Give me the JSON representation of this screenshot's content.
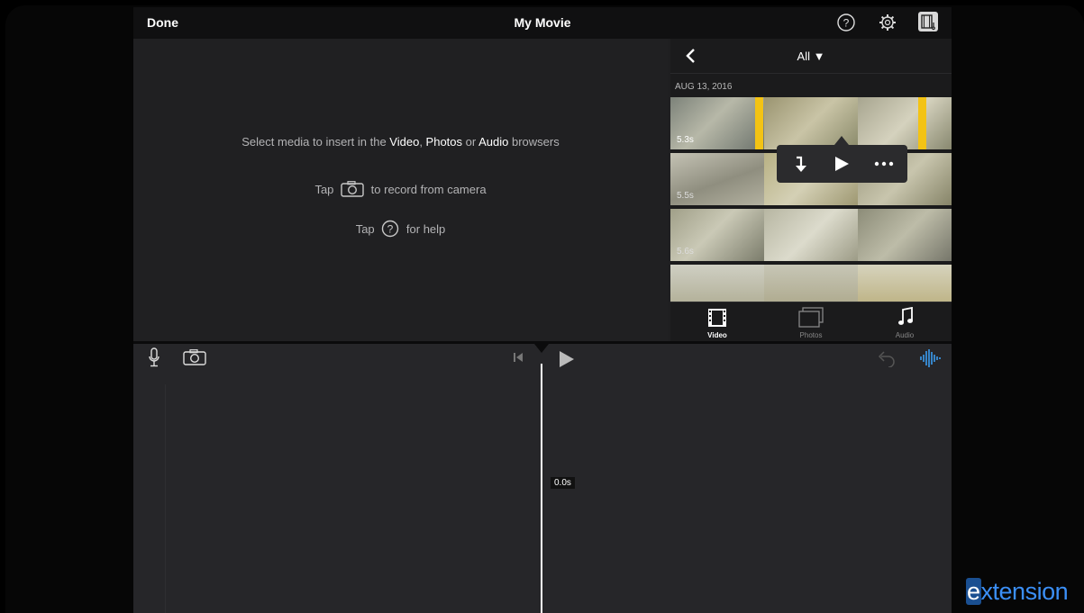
{
  "header": {
    "done_label": "Done",
    "title": "My Movie",
    "icons": [
      "help-icon",
      "settings-gear-icon",
      "project-settings-icon"
    ]
  },
  "viewer": {
    "line1": {
      "pre": "Select media to insert in the ",
      "video": "Video",
      "sep1": ", ",
      "photos": "Photos",
      "sep2": " or ",
      "audio": "Audio",
      "post": " browsers"
    },
    "line2": {
      "pre": "Tap",
      "post": "to record from camera"
    },
    "line3": {
      "pre": "Tap",
      "post": "for help"
    }
  },
  "browser": {
    "filter_label": "All ▼",
    "date_header": "AUG 13, 2016",
    "clips": [
      {
        "duration": "5.3s"
      },
      {
        "duration": "5.5s"
      },
      {
        "duration": "5.6s"
      },
      {
        "duration": ""
      }
    ],
    "popover_actions": [
      "insert-clip-icon",
      "play-icon",
      "more-icon"
    ],
    "tabs": [
      {
        "label": "Video",
        "icon": "film-strip-icon",
        "active": true
      },
      {
        "label": "Photos",
        "icon": "photos-icon",
        "active": false
      },
      {
        "label": "Audio",
        "icon": "music-note-icon",
        "active": false
      }
    ]
  },
  "timeline": {
    "timecode": "0.0s",
    "tools": [
      "microphone-icon",
      "camera-icon",
      "skip-to-start-icon",
      "play-icon",
      "undo-icon",
      "audio-waveform-icon"
    ]
  },
  "watermark": {
    "e": "e",
    "rest": "xtension"
  },
  "colors": {
    "selection": "#f3c314",
    "accent": "#3b8ff6",
    "background": "#1f1f21"
  }
}
